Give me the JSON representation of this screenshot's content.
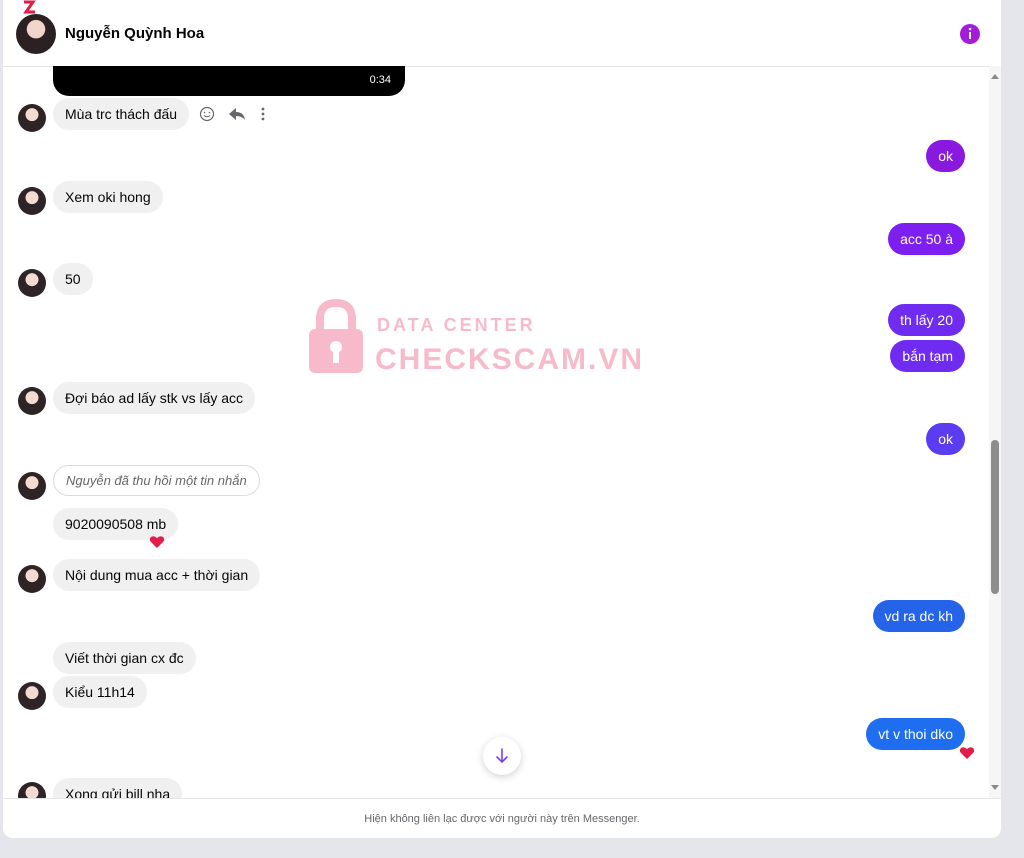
{
  "conversation": {
    "contact_name": "Nguyễn Quỳnh Hoa",
    "footer_notice": "Hiện không liên lạc được với người này trên Messenger."
  },
  "video": {
    "duration": "0:34"
  },
  "messages": [
    {
      "id": "m1",
      "side": "in",
      "text": "Mùa trc thách đấu"
    },
    {
      "id": "m2",
      "side": "out",
      "text": "ok",
      "color": "#8a19e0"
    },
    {
      "id": "m3",
      "side": "in",
      "text": "Xem oki hong"
    },
    {
      "id": "m4",
      "side": "out",
      "text": "acc 50 à",
      "color": "#7c1ff0"
    },
    {
      "id": "m5",
      "side": "in",
      "text": "50"
    },
    {
      "id": "m6",
      "side": "out",
      "text": "th lấy 20",
      "color": "#6f2cf0"
    },
    {
      "id": "m7",
      "side": "out",
      "text": "bắn tạm",
      "color": "#6f2cf0"
    },
    {
      "id": "m8",
      "side": "in",
      "text": "Đợi báo ad lấy stk vs lấy acc"
    },
    {
      "id": "m9",
      "side": "out",
      "text": "ok",
      "color": "#5b3cf0"
    },
    {
      "id": "m10",
      "side": "recalled",
      "text": "Nguyễn đã thu hồi một tin nhắn"
    },
    {
      "id": "m11",
      "side": "in",
      "text": "9020090508 mb"
    },
    {
      "id": "m12",
      "side": "in",
      "text": "Nội dung mua acc + thời gian"
    },
    {
      "id": "m13",
      "side": "out",
      "text": "vd ra dc kh",
      "color": "#2563e8"
    },
    {
      "id": "m14",
      "side": "in",
      "text": "Viết thời gian cx đc"
    },
    {
      "id": "m15",
      "side": "in",
      "text": "Kiểu 11h14"
    },
    {
      "id": "m16",
      "side": "out",
      "text": "vt v thoi dko",
      "color": "#1f6ef0"
    },
    {
      "id": "m17",
      "side": "in",
      "text": "Xong gửi bill nha"
    }
  ],
  "watermark": {
    "line1": "DATA CENTER",
    "line2": "CHECKSCAM.VN"
  },
  "icons": {
    "info": "info-icon",
    "emoji": "emoji-icon",
    "reply": "reply-icon",
    "more": "more-icon",
    "heart": "heart-icon",
    "scroll_down": "arrow-down-icon"
  },
  "colors": {
    "accent": "#a21cd9",
    "heart": "#e11d48"
  }
}
